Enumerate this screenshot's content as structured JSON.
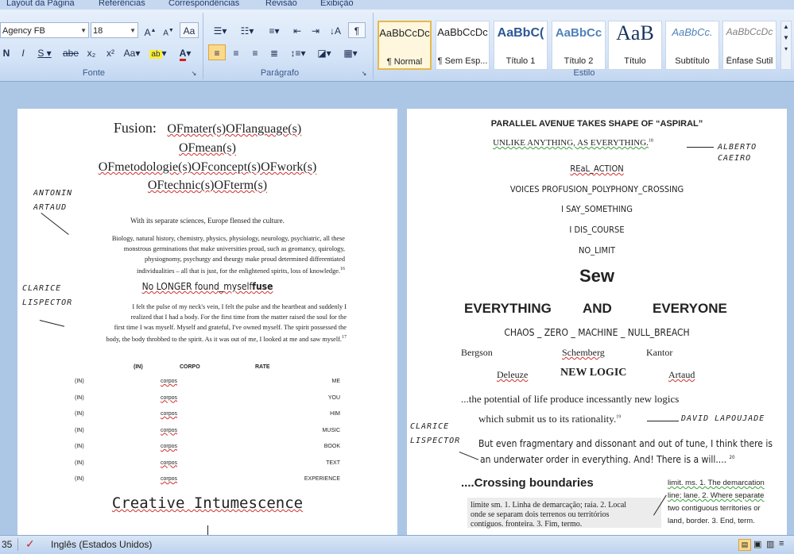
{
  "ribbon": {
    "tabs": [
      "Layout da Página",
      "Referências",
      "Correspondências",
      "Revisão",
      "Exibição"
    ],
    "font": {
      "name": "Agency FB",
      "size": "18",
      "group_label": "Fonte",
      "buttons": [
        "N",
        "I",
        "S",
        "abe",
        "x₂",
        "x²",
        "Aa",
        "A",
        "A"
      ]
    },
    "paragraph": {
      "group_label": "Parágrafo"
    },
    "styles": {
      "group_label": "Estilo",
      "items": [
        {
          "sample": "AaBbCcDc",
          "name": "¶ Normal"
        },
        {
          "sample": "AaBbCcDc",
          "name": "¶ Sem Esp..."
        },
        {
          "sample": "AaBbC(",
          "name": "Título 1"
        },
        {
          "sample": "AaBbCc",
          "name": "Título 2"
        },
        {
          "sample": "AaB",
          "name": "Título"
        },
        {
          "sample": "AaBbCc.",
          "name": "Subtítulo"
        },
        {
          "sample": "AaBbCcDc",
          "name": "Ênfase Sutil"
        }
      ]
    }
  },
  "left_page": {
    "title_line1_a": "Fusion:",
    "title_line1_b": "OFmater(s)OFlanguage(s)",
    "title_line2": "OFmean(s)",
    "title_line3": "OFmetodologie(s)OFconcept(s)OFwork(s)",
    "title_line4": "OFtechnic(s)OFterm(s)",
    "note_artaud": "ANTONIN ARTAUD",
    "para1": "With its separate sciences, Europe flensed the culture.",
    "para2_l1": "Biology, natural history, chemistry, physics, physiology, neurology, psychiatric, all these",
    "para2_l2": "monstrous germinations that make universities proud, such as geomancy, quirology,",
    "para2_l3": "physiognomy, psychurgy and theurgy make proud determined differentiated",
    "para2_l4": "individualities – all that is just, for the enlightened spirits, loss of knowledge.",
    "para2_ref": "16",
    "heading2_a": "No LONGER found_myself",
    "heading2_b": "fuse",
    "note_clarice": "CLARICE LISPECTOR",
    "para3_l1": "I felt the pulse of my neck's vein, I felt the pulse and the heartbeat and suddenly I",
    "para3_l2": "realized that I had a body. For the first time from the matter raised the soul for the",
    "para3_l3": "first time I was myself. Myself and grateful, I've owned myself. The spirit possessed the",
    "para3_l4": "body, the body throbbed to the spirit. As it was out of me, I looked at me and saw myself.",
    "para3_ref": "17",
    "table": {
      "headers": [
        "(IN)",
        "CORPO",
        "RATE"
      ],
      "rows": [
        {
          "a": "(IN)",
          "b": "corpos",
          "c": "ME"
        },
        {
          "a": "(IN)",
          "b": "corpos",
          "c": "YOU"
        },
        {
          "a": "(IN)",
          "b": "corpos",
          "c": "HIM"
        },
        {
          "a": "(IN)",
          "b": "corpos",
          "c": "MUSIC"
        },
        {
          "a": "(IN)",
          "b": "corpos",
          "c": "BOOK"
        },
        {
          "a": "(IN)",
          "b": "corpos",
          "c": "TEXT"
        },
        {
          "a": "(IN)",
          "b": "corpos",
          "c": "EXPERIENCE"
        }
      ]
    },
    "footer_title": "Creative Intumescence"
  },
  "right_page": {
    "title": "PARALLEL AVENUE TAKES SHAPE OF “ASPIRAL”",
    "line_unlike": "UNLIKE ANYTHING, AS EVERYTHING.",
    "line_unlike_ref": "18",
    "note_caeiro": "ALBERTO CAEIRO",
    "l1": "REaL_ACTION",
    "l2": "VOICES PROFUSION_POLYPHONY_CROSSING",
    "l3": "I SAY_SOMETHING",
    "l4": "I DIS_COURSE",
    "l5": "NO_LIMIT",
    "sew": "Sew",
    "everything": "EVERYTHING",
    "and": "AND",
    "everyone": "EVERYONE",
    "chaos": "CHAOS _ ZERO _ MACHINE _ NULL_BREACH",
    "names_row1": [
      "Bergson",
      "Schemberg",
      "Kantor"
    ],
    "names_row2_a": "Deleuze",
    "new_logic": "NEW LOGIC",
    "names_row2_b": "Artaud",
    "potential_l1": "...the potential of life produce incessantly new logics",
    "potential_l2": "which submit us to its rationality.",
    "potential_ref": "19",
    "note_lapoujade": "DAVID LAPOUJADE",
    "note_clarice2": "CLARICE LISPECTOR",
    "but_l1": "But even fragmentary and dissonant and out of tune, I think there is",
    "but_l2": "an underwater order in everything. And! There is a will.... ",
    "but_ref": "20",
    "crossing": "....Crossing boundaries",
    "dict_pt_l1": "limite sm. 1. Linha de demarcação; raia. 2. Local",
    "dict_pt_l2": "onde se separam dois terrenos ou territórios",
    "dict_pt_l3": "contíguos. fronteira. 3. Fim, termo.",
    "dict_en_l1": "limit. ms. 1. The demarcation",
    "dict_en_l2": "line; lane. 2. Where separate",
    "dict_en_l3": "two contiguous territories or",
    "dict_en_l4": "land, border. 3. End, term."
  },
  "status_bar": {
    "page_count": "35",
    "language": "Inglês (Estados Unidos)"
  }
}
